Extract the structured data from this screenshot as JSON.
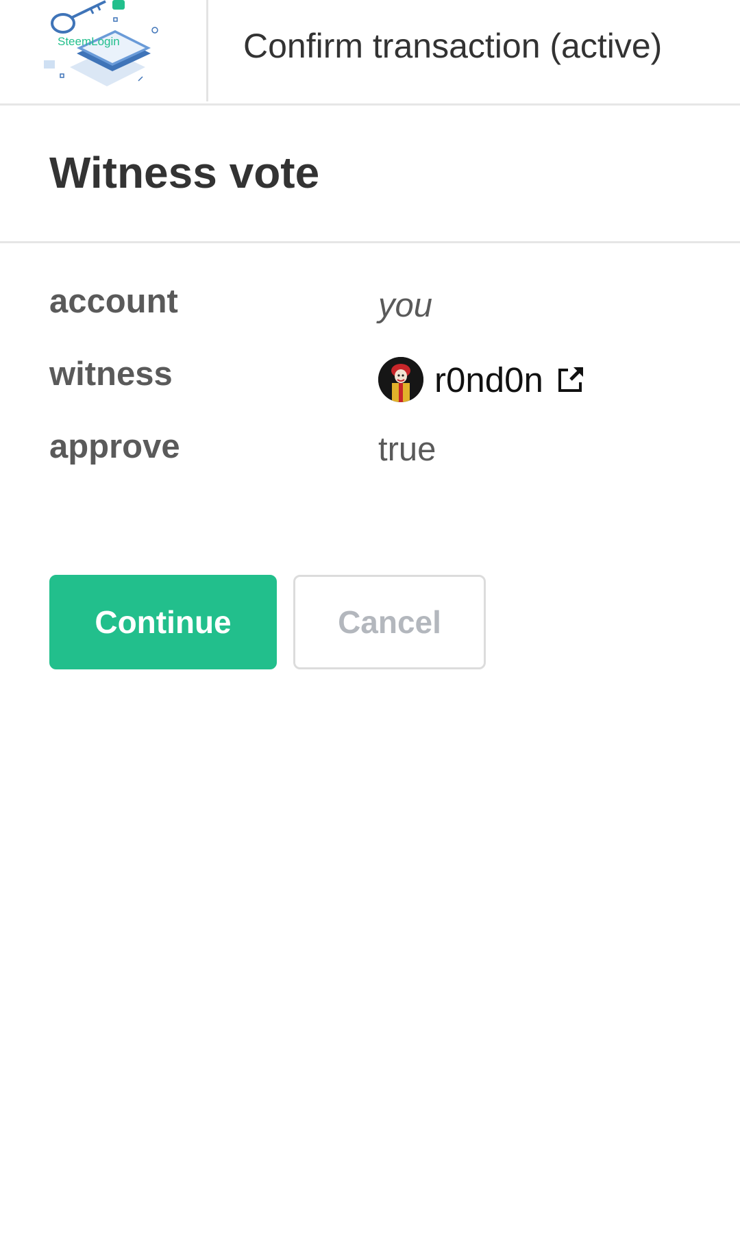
{
  "header": {
    "logo_text": "SteemLogin",
    "title": "Confirm transaction (active)"
  },
  "operation": {
    "title": "Witness vote",
    "fields": {
      "account": {
        "label": "account",
        "value": "you"
      },
      "witness": {
        "label": "witness",
        "value": "r0nd0n",
        "avatar_icon": "avatar-icon",
        "link_icon": "external-link-icon"
      },
      "approve": {
        "label": "approve",
        "value": "true"
      }
    }
  },
  "actions": {
    "continue_label": "Continue",
    "cancel_label": "Cancel"
  },
  "colors": {
    "primary": "#22bf8c",
    "text": "#333333",
    "muted": "#5a5a5a",
    "cancel_text": "#b3b7bd",
    "divider": "#e6e6e6"
  }
}
